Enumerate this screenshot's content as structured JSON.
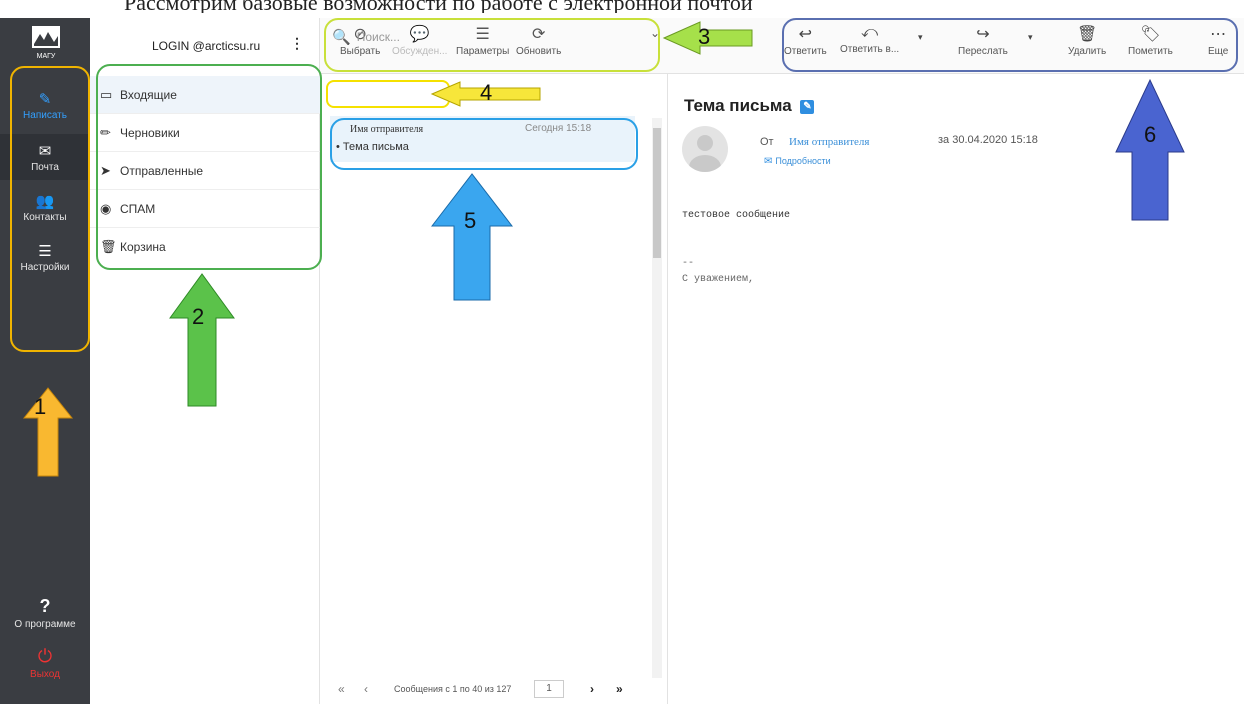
{
  "caption": "Рассмотрим базовые возможности по работе с электронной почтой",
  "rail": {
    "logo": "МАГУ",
    "items": [
      {
        "label": "Написать"
      },
      {
        "label": "Почта"
      },
      {
        "label": "Контакты"
      },
      {
        "label": "Настройки"
      }
    ],
    "about": "О программе",
    "logout": "Выход"
  },
  "account": {
    "login": "LOGIN @arcticsu.ru"
  },
  "folders": [
    {
      "label": "Входящие",
      "icon": "inbox-icon"
    },
    {
      "label": "Черновики",
      "icon": "pencil-icon"
    },
    {
      "label": "Отправленные",
      "icon": "paper-plane-icon"
    },
    {
      "label": "СПАМ",
      "icon": "fire-icon"
    },
    {
      "label": "Корзина",
      "icon": "trash-icon"
    }
  ],
  "list_toolbar": {
    "select": "Выбрать",
    "discuss": "Обсужден...",
    "params": "Параметры",
    "refresh": "Обновить"
  },
  "search": {
    "placeholder": "Поиск..."
  },
  "message": {
    "sender": "Имя отправителя",
    "date": "Сегодня 15:18",
    "subject": "Тема письма"
  },
  "pager": {
    "info": "Сообщения с 1 по 40 из 127",
    "page": "1"
  },
  "preview_toolbar": {
    "reply": "Ответить",
    "reply_all": "Ответить в...",
    "forward": "Переслать",
    "delete": "Удалить",
    "mark": "Пометить",
    "more": "Еще"
  },
  "preview": {
    "subject": "Тема письма",
    "from_label": "От",
    "from_name": "Имя отправителя",
    "date": "за 30.04.2020 15:18",
    "details": "Подробности",
    "body": "тестовое сообщение",
    "sig_dash": "--",
    "signature": "С уважением,"
  },
  "annotations": [
    "1",
    "2",
    "3",
    "4",
    "5",
    "6"
  ],
  "colors": {
    "rail": "#3a3d42",
    "accent": "#2f8ee0",
    "box1": "#f0b400",
    "box2": "#4caf50",
    "box3": "#c8e03a",
    "box4": "#f5e100",
    "box5": "#2aa0e6",
    "box6": "#5a6fb0"
  }
}
